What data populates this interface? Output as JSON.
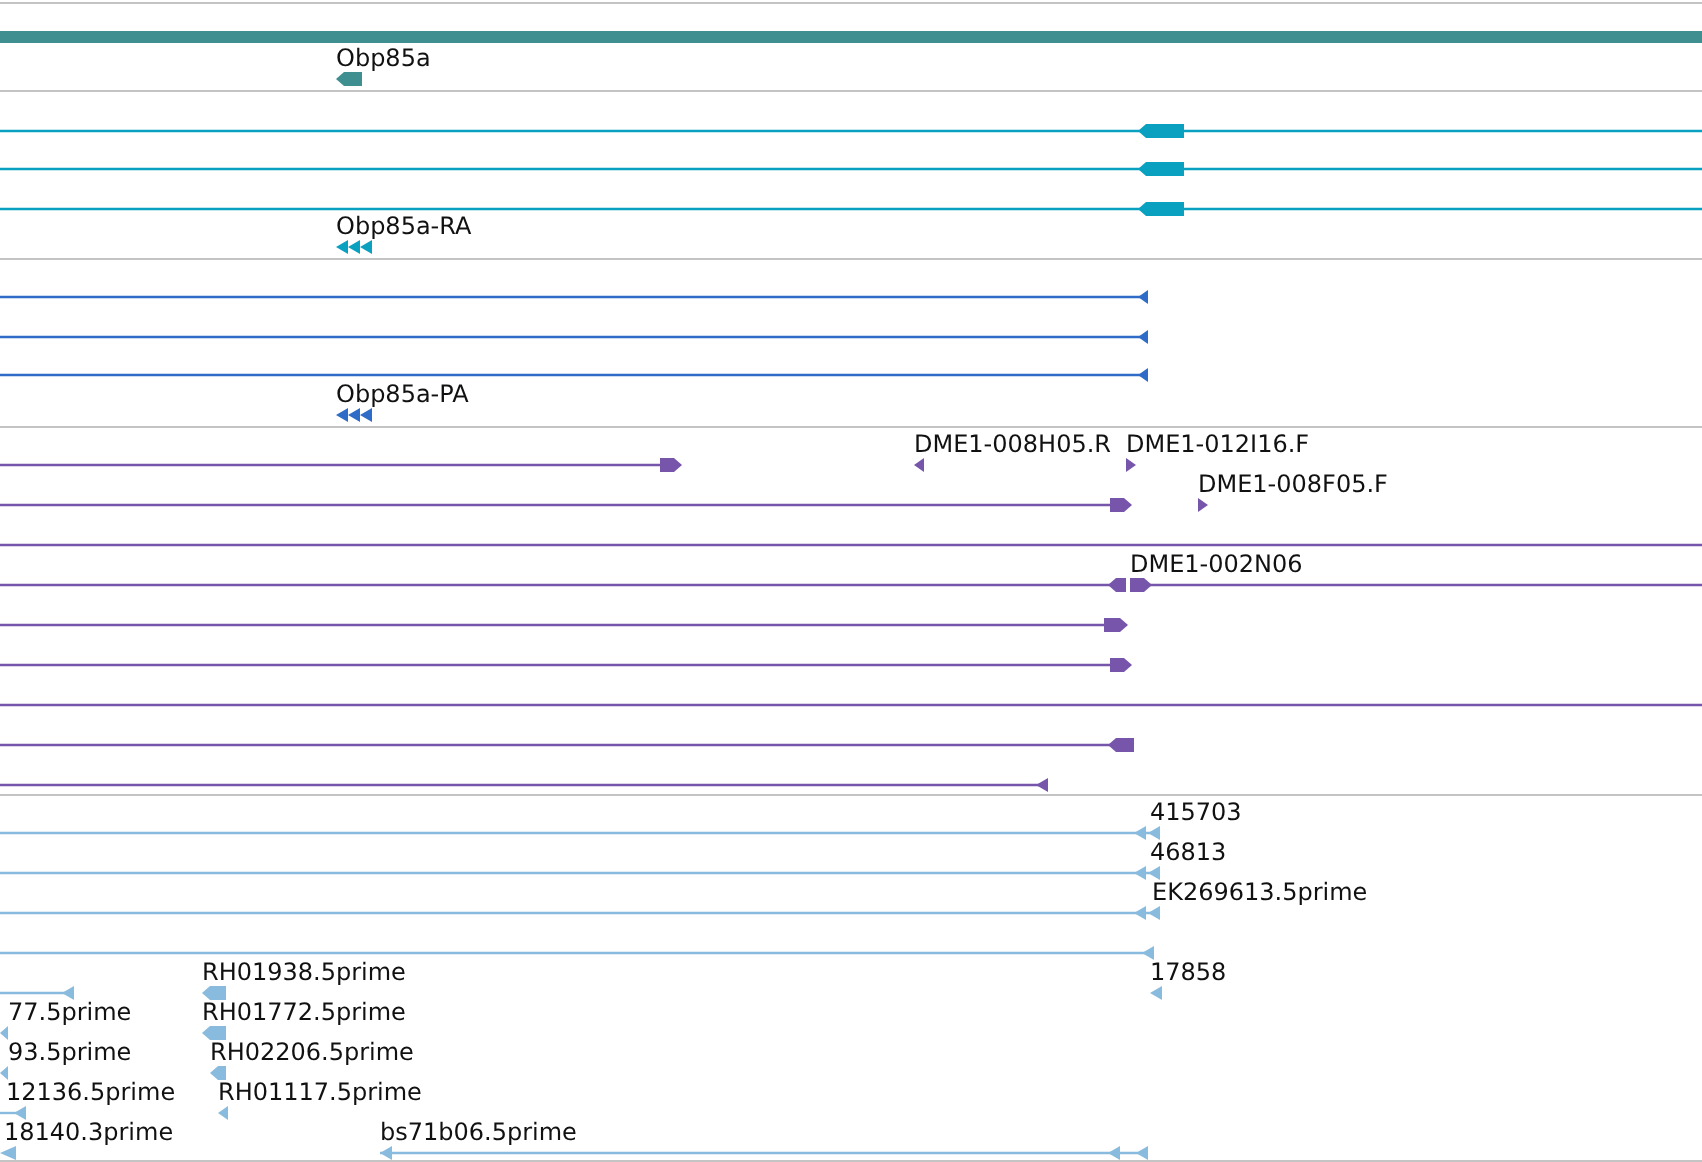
{
  "tracks": [
    {
      "kind": "gene",
      "color": "#3f8f91",
      "features": [
        {
          "label": "Obp85a",
          "kind": "arrow",
          "reverse": true
        }
      ]
    },
    {
      "kind": "transcript",
      "color": "#0aa0c0",
      "features": [
        {
          "kind": "arrow",
          "reverse": true
        },
        {
          "kind": "arrow",
          "reverse": true
        },
        {
          "kind": "arrow",
          "reverse": true
        },
        {
          "label": "Obp85a-RA",
          "kind": "arrow",
          "reverse": true
        }
      ]
    },
    {
      "kind": "protein",
      "color": "#2f6cc8",
      "features": [
        {
          "kind": "arrow",
          "reverse": true
        },
        {
          "kind": "arrow",
          "reverse": true
        },
        {
          "kind": "arrow",
          "reverse": true
        },
        {
          "label": "Obp85a-PA",
          "kind": "arrow",
          "reverse": true
        }
      ]
    },
    {
      "kind": "clone",
      "color": "#7755aa",
      "features": [
        {
          "kind": "arrow",
          "reverse": false
        },
        {
          "label": "DME1-008H05.R",
          "kind": "arrow",
          "reverse": true
        },
        {
          "label": "DME1-012I16.F",
          "kind": "arrow",
          "reverse": false
        },
        {
          "kind": "arrow",
          "reverse": false
        },
        {
          "label": "DME1-008F05.F",
          "kind": "arrow",
          "reverse": false
        },
        {
          "kind": "line"
        },
        {
          "kind": "arrow",
          "reverse": true
        },
        {
          "label": "DME1-002N06",
          "kind": "arrow",
          "reverse": false
        },
        {
          "kind": "arrow",
          "reverse": false
        },
        {
          "kind": "arrow",
          "reverse": false
        },
        {
          "kind": "line"
        },
        {
          "kind": "arrow",
          "reverse": true
        },
        {
          "kind": "arrow",
          "reverse": true
        }
      ]
    },
    {
      "kind": "est",
      "color": "#88bbdd",
      "features": [
        {
          "label": "415703",
          "kind": "arrow",
          "reverse": true
        },
        {
          "label": "46813",
          "kind": "arrow",
          "reverse": true
        },
        {
          "label": "EK269613.5prime",
          "kind": "arrow",
          "reverse": true
        },
        {
          "kind": "arrow",
          "reverse": true
        },
        {
          "label": "17858",
          "kind": "arrow",
          "reverse": true
        },
        {
          "kind": "arrow",
          "reverse": true
        },
        {
          "label": "RH01938.5prime",
          "kind": "arrow",
          "reverse": true
        },
        {
          "label": "77.5prime",
          "kind": "arrow",
          "reverse": true
        },
        {
          "label": "RH01772.5prime",
          "kind": "arrow",
          "reverse": true
        },
        {
          "label": "93.5prime",
          "kind": "arrow",
          "reverse": true
        },
        {
          "label": "RH02206.5prime",
          "kind": "arrow",
          "reverse": true
        },
        {
          "label": "12136.5prime",
          "kind": "arrow",
          "reverse": true
        },
        {
          "label": "RH01117.5prime",
          "kind": "arrow",
          "reverse": true
        },
        {
          "label": "18140.3prime",
          "kind": "arrow",
          "reverse": true
        },
        {
          "label": "bs71b06.5prime",
          "kind": "arrow",
          "reverse": true
        }
      ]
    }
  ]
}
